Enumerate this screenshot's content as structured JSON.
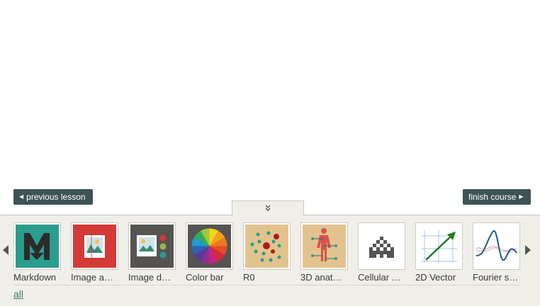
{
  "nav": {
    "previous_label": "previous lesson",
    "finish_label": "finish course"
  },
  "tray": {
    "toggle_icon": "double-chevron-down-icon",
    "all_label": "all"
  },
  "lessons": [
    {
      "label": "Markdown",
      "icon": "markdown-icon"
    },
    {
      "label": "Image a…",
      "icon": "image-a-icon"
    },
    {
      "label": "Image d…",
      "icon": "image-d-icon"
    },
    {
      "label": "Color bar",
      "icon": "color-wheel-icon"
    },
    {
      "label": "R0",
      "icon": "r0-dots-icon"
    },
    {
      "label": "3D anat…",
      "icon": "anatomy-icon"
    },
    {
      "label": "Cellular …",
      "icon": "cellular-automaton-icon"
    },
    {
      "label": "2D Vector",
      "icon": "vector-icon"
    },
    {
      "label": "Fourier s…",
      "icon": "fourier-wave-icon"
    }
  ],
  "colors": {
    "button_bg": "#3d5356",
    "tray_bg": "#f0eee9",
    "link": "#3c7b6e"
  }
}
